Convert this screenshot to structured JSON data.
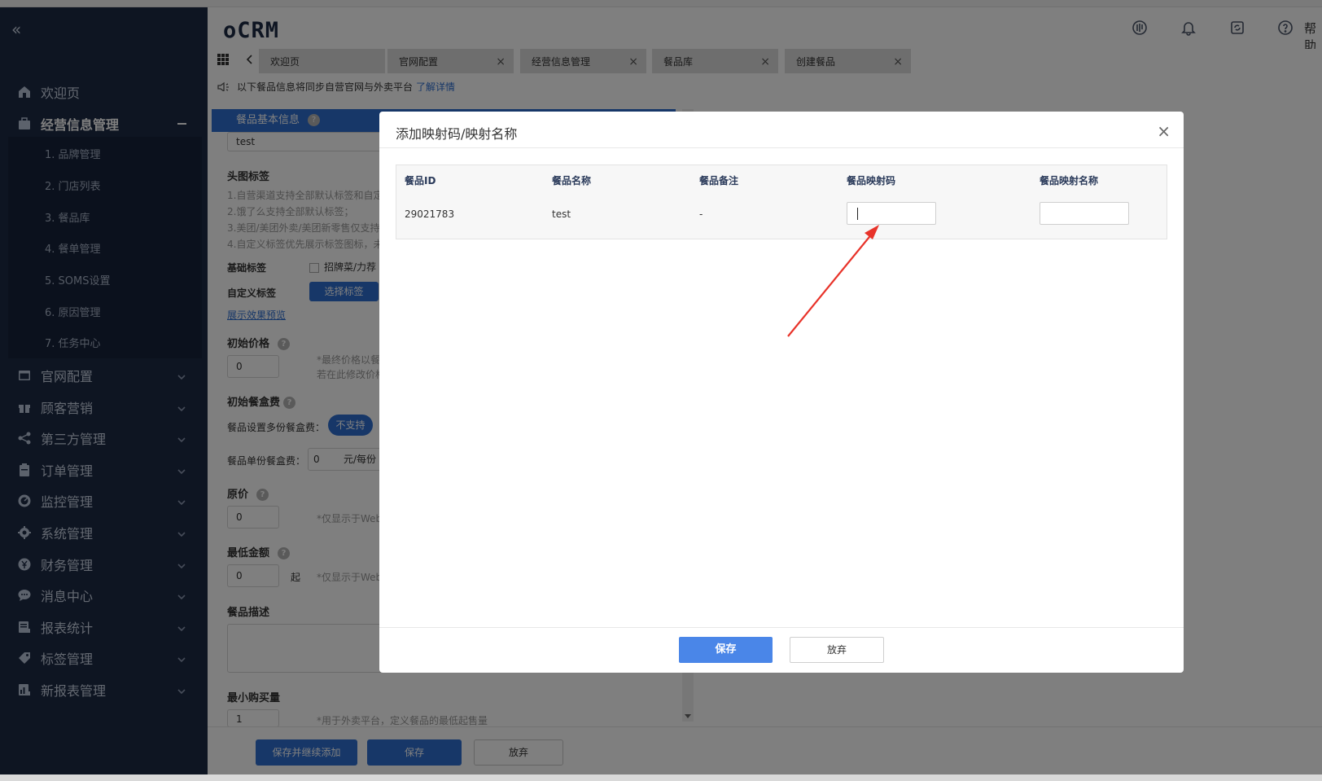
{
  "sidebar": {
    "items": [
      {
        "label": "欢迎页",
        "icon": "home-icon"
      },
      {
        "label": "经营信息管理",
        "icon": "briefcase-icon"
      },
      {
        "label": "官网配置",
        "icon": "window-icon"
      },
      {
        "label": "顾客营销",
        "icon": "gift-icon"
      },
      {
        "label": "第三方管理",
        "icon": "share-icon"
      },
      {
        "label": "订单管理",
        "icon": "clipboard-icon"
      },
      {
        "label": "监控管理",
        "icon": "monitor-icon"
      },
      {
        "label": "系统管理",
        "icon": "gear-icon"
      },
      {
        "label": "财务管理",
        "icon": "money-icon"
      },
      {
        "label": "消息中心",
        "icon": "chat-icon"
      },
      {
        "label": "报表统计",
        "icon": "report-icon"
      },
      {
        "label": "标签管理",
        "icon": "tag-icon"
      },
      {
        "label": "新报表管理",
        "icon": "chart-icon"
      }
    ],
    "subitems": [
      "1. 品牌管理",
      "2. 门店列表",
      "3. 餐品库",
      "4. 餐单管理",
      "5. SOMS设置",
      "6. 原因管理",
      "7. 任务中心"
    ]
  },
  "header": {
    "logo": "oCRM",
    "help": "帮助"
  },
  "tabs": [
    "欢迎页",
    "官网配置",
    "经营信息管理",
    "餐品库",
    "创建餐品"
  ],
  "notice": {
    "text": "以下餐品信息将同步自营官网与外卖平台",
    "link": "了解详情"
  },
  "form": {
    "section_title": "餐品基本信息",
    "name_value": "test",
    "headimg_label": "头图标签",
    "headimg_notes": [
      "1.自营渠道支持全部默认标签和自定",
      "2.饿了么支持全部默认标签；",
      "3.美团/美团外卖/美团新零售仅支持",
      "4.自定义标签优先展示标签图标，未"
    ],
    "base_tag_label": "基础标签",
    "base_tag_option": "招牌菜/力荐",
    "custom_tag_label": "自定义标签",
    "select_tag_btn": "选择标签",
    "preview_link": "展示效果预览",
    "init_price_label": "初始价格",
    "init_price_value": "0",
    "init_price_note1": "*最终价格以餐",
    "init_price_note2": "若在此修改价格",
    "box_fee_label": "初始餐盒费",
    "multi_box_label": "餐品设置多份餐盒费：",
    "multi_box_value": "不支持",
    "unit_box_label": "餐品单份餐盒费：",
    "unit_box_value": "0",
    "unit_box_unit": "元/每份",
    "orig_price_label": "原价",
    "orig_price_value": "0",
    "orig_price_note": "*仅显示于Web",
    "min_amount_label": "最低金额",
    "min_amount_value": "0",
    "min_amount_suffix": "起",
    "min_amount_note": "*仅显示于Web",
    "desc_label": "餐品描述",
    "min_qty_label": "最小购买量",
    "min_qty_value": "1",
    "min_qty_note": "*用于外卖平台，定义餐品的最低起售量"
  },
  "bottom": {
    "save_continue": "保存并继续添加",
    "save": "保存",
    "discard": "放弃"
  },
  "modal": {
    "title": "添加映射码/映射名称",
    "columns": [
      "餐品ID",
      "餐品名称",
      "餐品备注",
      "餐品映射码",
      "餐品映射名称"
    ],
    "row": {
      "id": "29021783",
      "name": "test",
      "remark": "-",
      "code": "",
      "map_name": ""
    },
    "save": "保存",
    "discard": "放弃"
  },
  "colors": {
    "sidebar": "#1d2b45",
    "primary": "#2f6fd1",
    "annotation": "#e8332a"
  }
}
